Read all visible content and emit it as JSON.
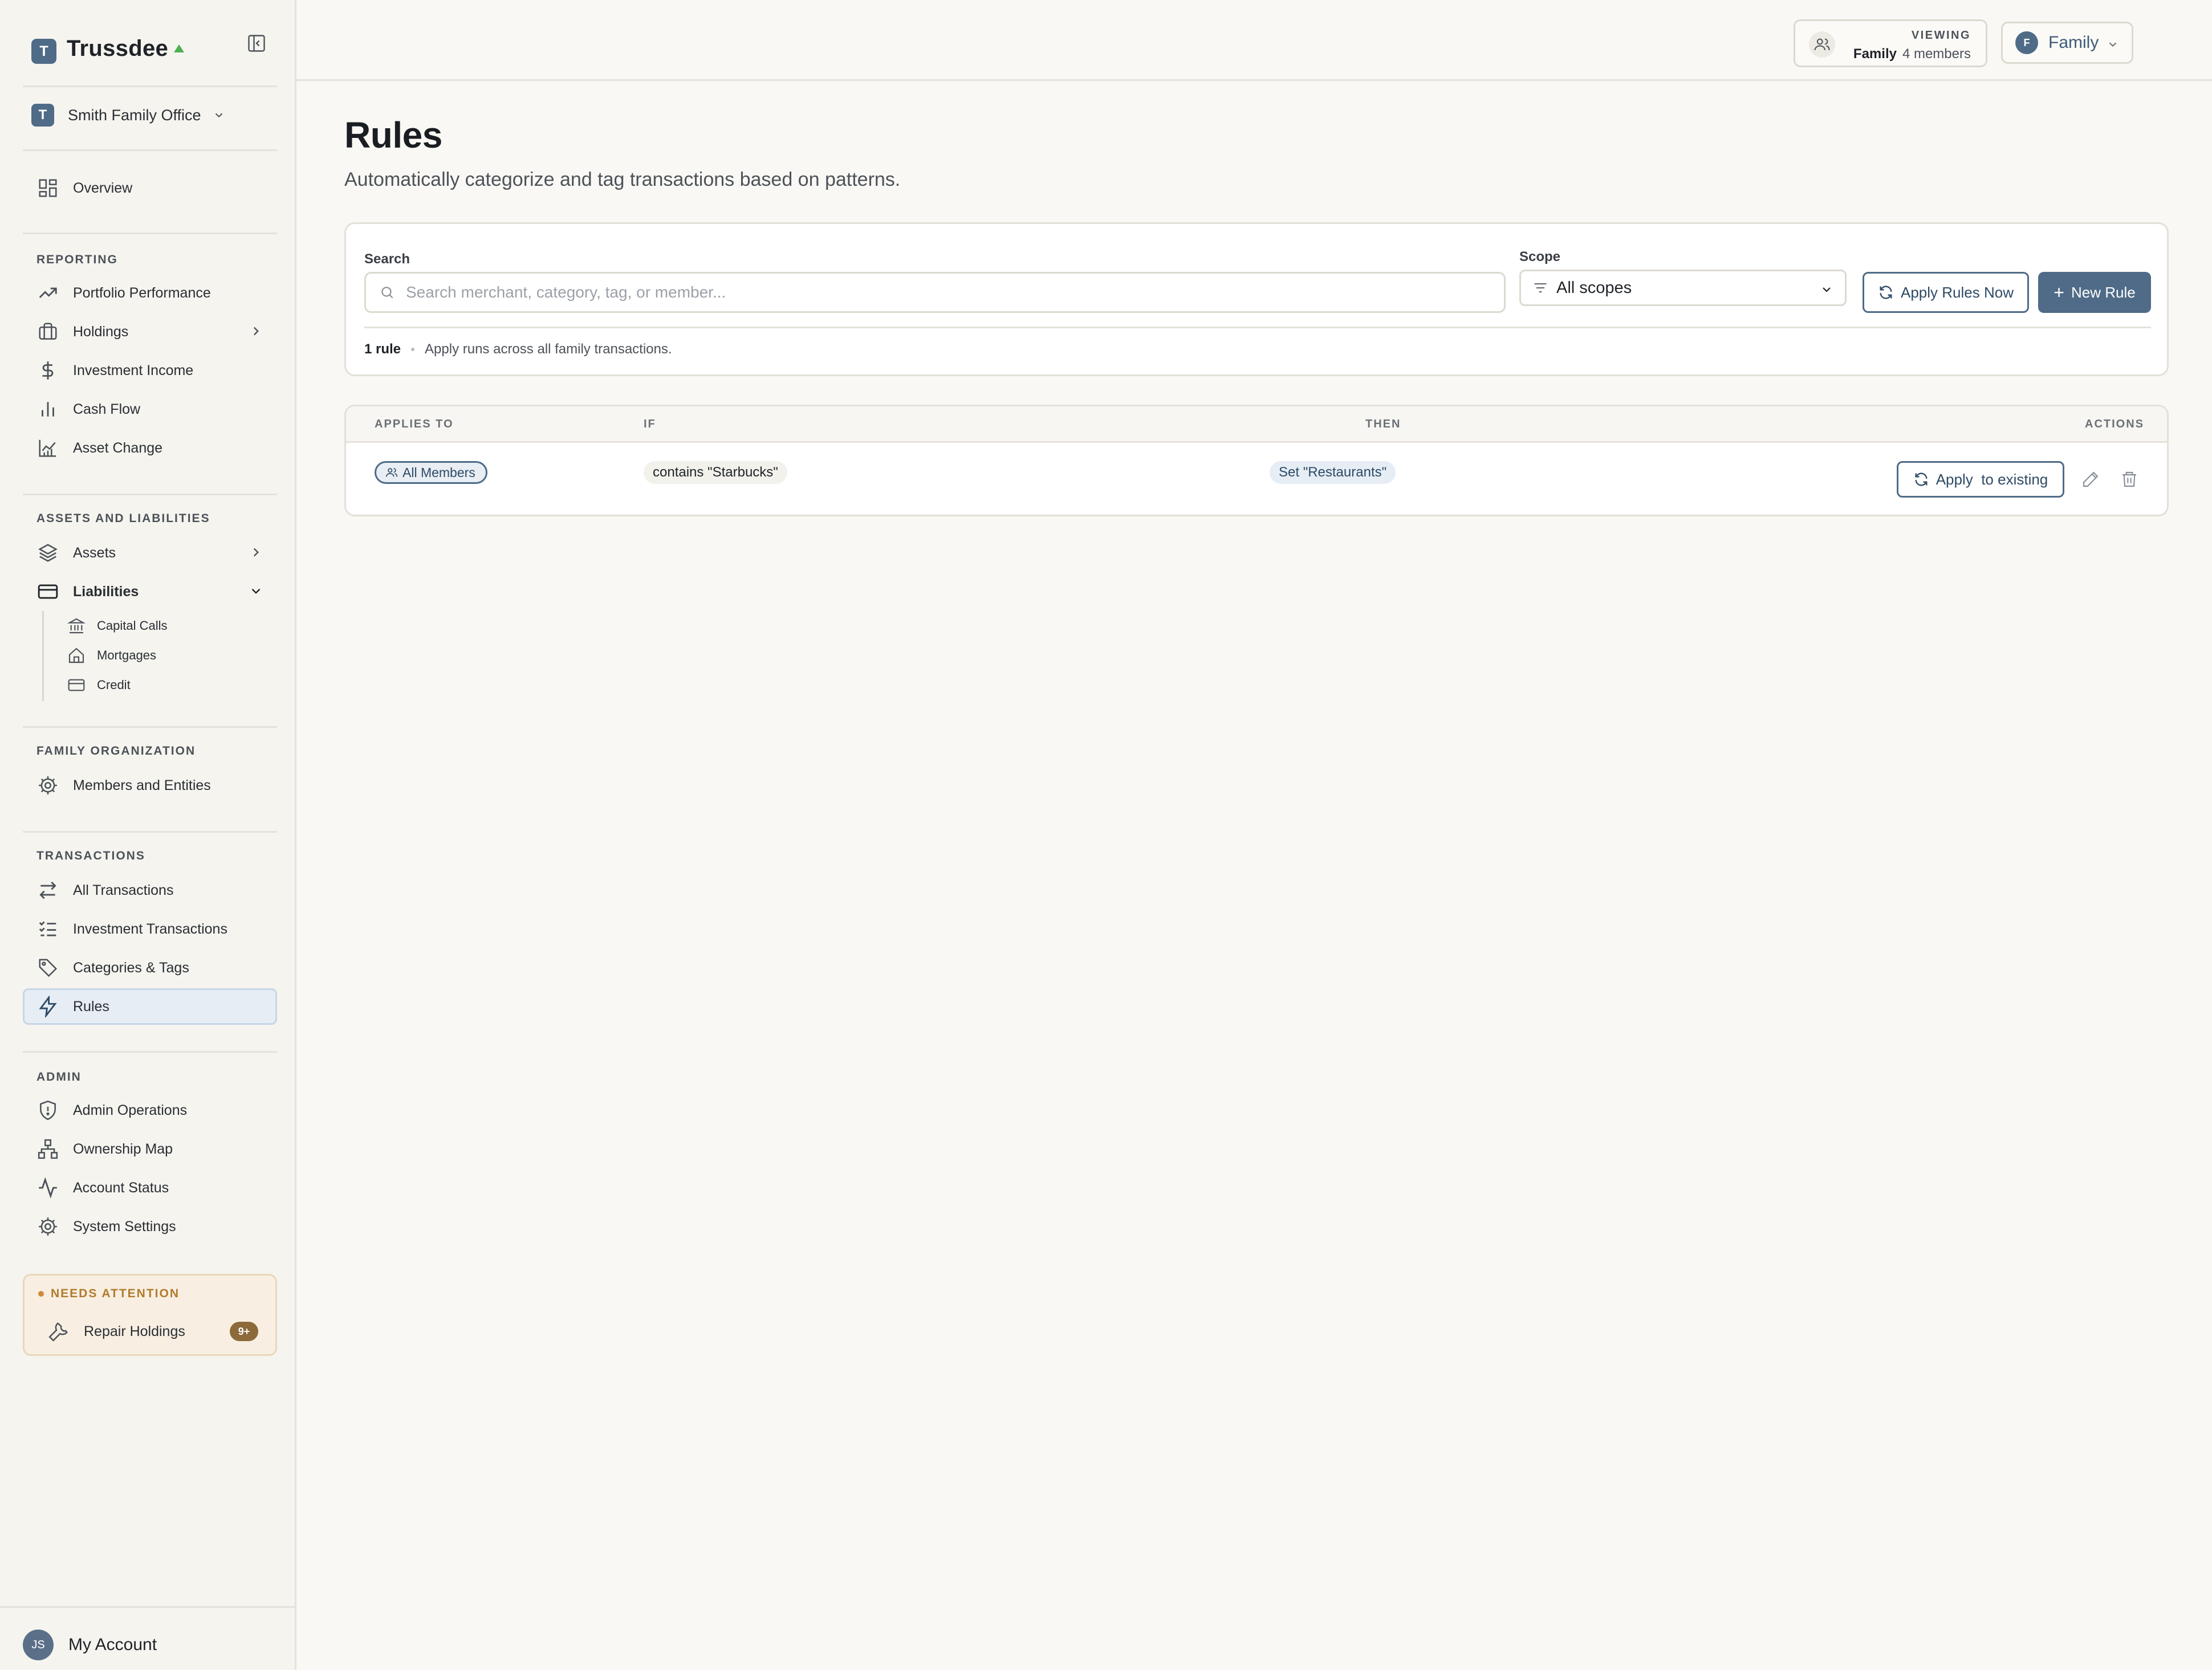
{
  "app": {
    "name": "Trussdee"
  },
  "org": {
    "name": "Smith Family Office",
    "initial": "T"
  },
  "sidebar": {
    "overview": "Overview",
    "reporting": {
      "label": "REPORTING",
      "items": [
        "Portfolio Performance",
        "Holdings",
        "Investment Income",
        "Cash Flow",
        "Asset Change"
      ]
    },
    "assets_liabilities": {
      "label": "ASSETS AND LIABILITIES",
      "items": [
        "Assets",
        "Liabilities"
      ],
      "liabilities_sub": [
        "Capital Calls",
        "Mortgages",
        "Credit"
      ]
    },
    "family_org": {
      "label": "FAMILY ORGANIZATION",
      "items": [
        "Members and Entities"
      ]
    },
    "transactions": {
      "label": "TRANSACTIONS",
      "items": [
        "All Transactions",
        "Investment Transactions",
        "Categories & Tags",
        "Rules"
      ]
    },
    "admin": {
      "label": "ADMIN",
      "items": [
        "Admin Operations",
        "Ownership Map",
        "Account Status",
        "System Settings"
      ]
    },
    "attention": {
      "label": "NEEDS ATTENTION",
      "item": "Repair Holdings",
      "count": "9+"
    }
  },
  "account": {
    "initials": "JS",
    "label": "My Account"
  },
  "topbar": {
    "viewing_label": "VIEWING",
    "viewing_scope": "Family",
    "viewing_members": "4 members",
    "family_initial": "F",
    "family_select": "Family"
  },
  "page": {
    "title": "Rules",
    "subtitle": "Automatically categorize and tag transactions based on patterns."
  },
  "filters": {
    "search_label": "Search",
    "search_placeholder": "Search merchant, category, tag, or member...",
    "scope_label": "Scope",
    "scope_value": "All scopes",
    "apply_rules_now": "Apply Rules Now",
    "new_rule": "New Rule",
    "rule_count": "1 rule",
    "rule_note": "Apply runs across all family transactions."
  },
  "table": {
    "headers": [
      "APPLIES TO",
      "IF",
      "THEN",
      "ACTIONS"
    ],
    "rows": [
      {
        "applies_to": "All Members",
        "condition": "contains \"Starbucks\"",
        "action": "Set \"Restaurants\"",
        "apply_existing": "Apply  to existing"
      }
    ]
  },
  "colors": {
    "accent": "#4f6b87",
    "active_bg": "#e6edf4",
    "attention_bg": "#f8efe2",
    "attention_text": "#b07a2e",
    "status_green": "#4caf50"
  }
}
